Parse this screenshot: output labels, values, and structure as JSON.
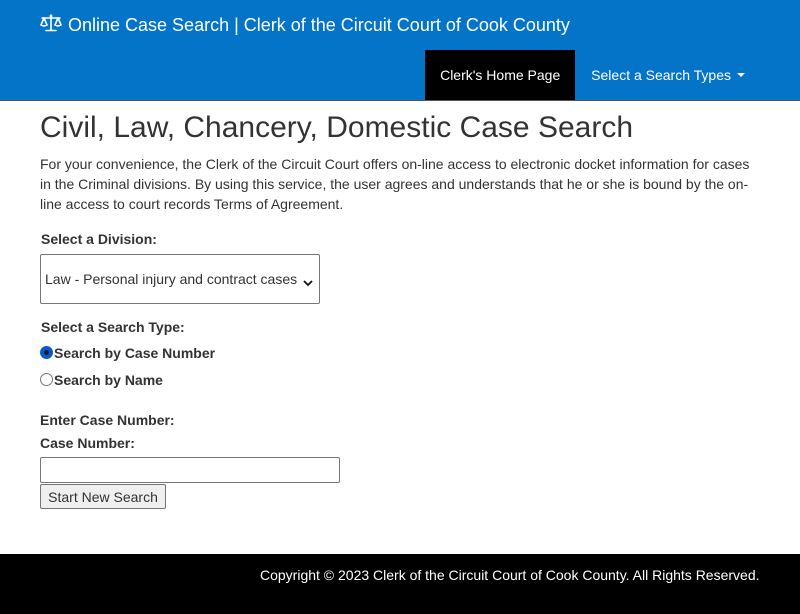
{
  "header": {
    "brand_title": "Online Case Search | Clerk of the Circuit Court of Cook County",
    "brand_icon": "scales-icon",
    "colors": {
      "bar": "#0474c8",
      "active_nav": "#000000"
    }
  },
  "nav": {
    "items": [
      {
        "label": "Clerk's Home Page",
        "active": true
      },
      {
        "label": "Select a Search Types",
        "dropdown": true
      }
    ]
  },
  "main": {
    "title": "Civil, Law, Chancery, Domestic Case Search",
    "intro": "For your convenience, the Clerk of the Circuit Court offers on-line access to electronic docket information for cases in the Criminal divisions. By using this service, the user agrees and understands that he or she is bound by the on-line access to court records Terms of Agreement.",
    "division_label": "Select a Division:",
    "division_value": "Law - Personal injury and contract cases",
    "search_type_label": "Select a Search Type:",
    "search_types": [
      {
        "label": "Search by Case Number",
        "selected": true
      },
      {
        "label": "Search by Name",
        "selected": false
      }
    ],
    "enter_label": "Enter Case Number:",
    "case_number_label": "Case Number:",
    "case_number_value": "",
    "submit_label": "Start New Search"
  },
  "footer": {
    "copyright": "Copyright © 2023 Clerk of the Circuit Court of Cook County. All Rights Reserved."
  }
}
